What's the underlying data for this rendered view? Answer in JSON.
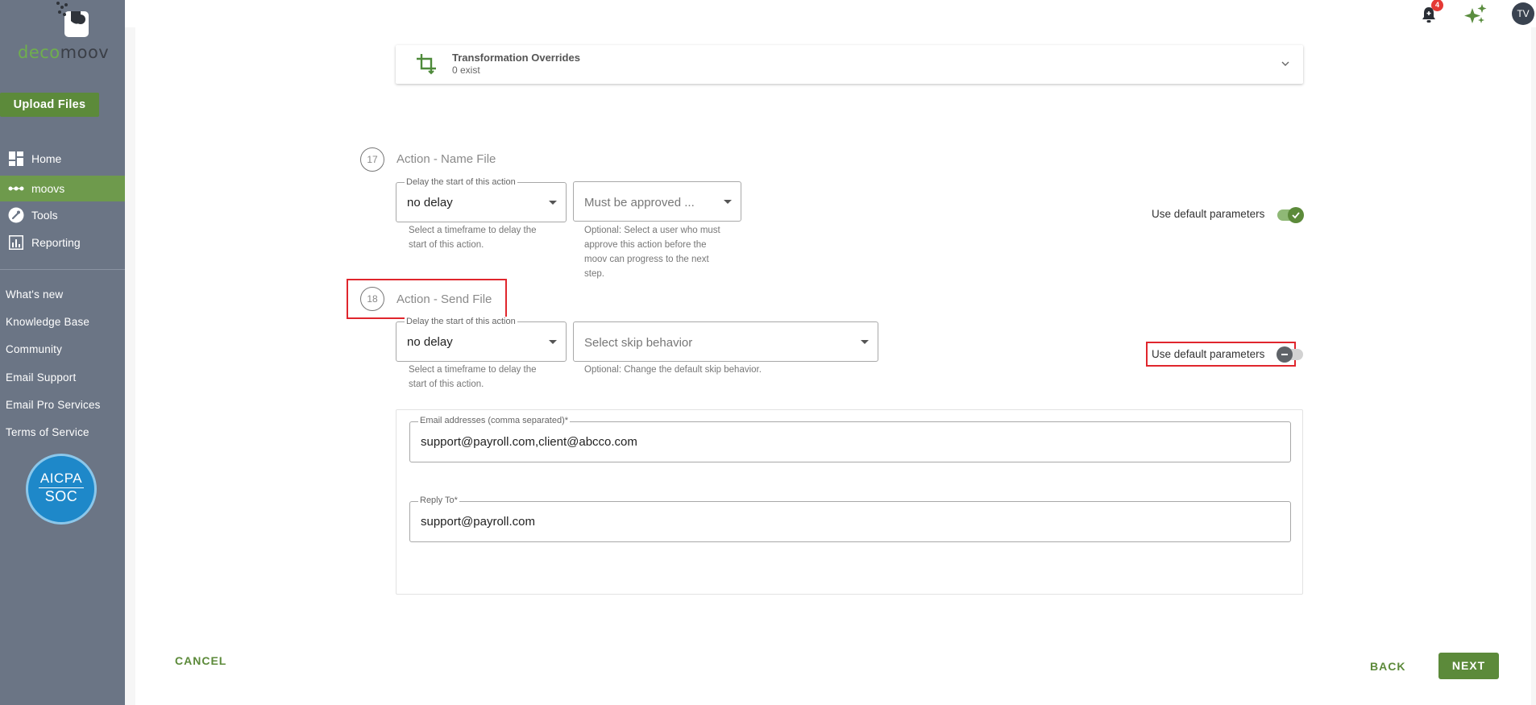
{
  "brand": {
    "logo_part1": "deco",
    "logo_part2": "moov"
  },
  "sidebar": {
    "upload_label": "Upload Files",
    "nav": [
      {
        "label": "Home",
        "icon": "dashboard-icon"
      },
      {
        "label": "moovs",
        "icon": "dots-icon"
      },
      {
        "label": "Tools",
        "icon": "wrench-icon"
      },
      {
        "label": "Reporting",
        "icon": "chart-icon"
      }
    ],
    "links": [
      "What's new",
      "Knowledge Base",
      "Community",
      "Email Support",
      "Email Pro Services",
      "Terms of Service"
    ],
    "badge": {
      "line1": "AICPA",
      "line2": "SOC"
    }
  },
  "topbar": {
    "notification_count": "4",
    "avatar_initials": "TV"
  },
  "override": {
    "title": "Transformation Overrides",
    "subtitle": "0 exist"
  },
  "step17": {
    "number": "17",
    "title": "Action - Name File",
    "delay_legend": "Delay the start of this action",
    "delay_value": "no delay",
    "delay_helper": "Select a timeframe to delay the start of this action.",
    "approver_placeholder": "Must be approved ...",
    "approver_helper": "Optional: Select a user who must approve this action before the moov can progress to the next step.",
    "toggle_label": "Use default parameters"
  },
  "step18": {
    "number": "18",
    "title": "Action - Send File",
    "delay_legend": "Delay the start of this action",
    "delay_value": "no delay",
    "delay_helper": "Select a timeframe to delay the start of this action.",
    "skip_placeholder": "Select skip behavior",
    "skip_helper": "Optional: Change the default skip behavior.",
    "toggle_label": "Use default parameters",
    "email_legend": "Email addresses (comma separated)*",
    "email_value": "support@payroll.com,client@abcco.com",
    "reply_legend": "Reply To*",
    "reply_value": "support@payroll.com"
  },
  "footer": {
    "cancel": "CANCEL",
    "back": "BACK",
    "next": "NEXT"
  },
  "colors": {
    "sidebar": "#6b7585",
    "accent": "#5c8a3a",
    "highlight": "#e0262d"
  }
}
